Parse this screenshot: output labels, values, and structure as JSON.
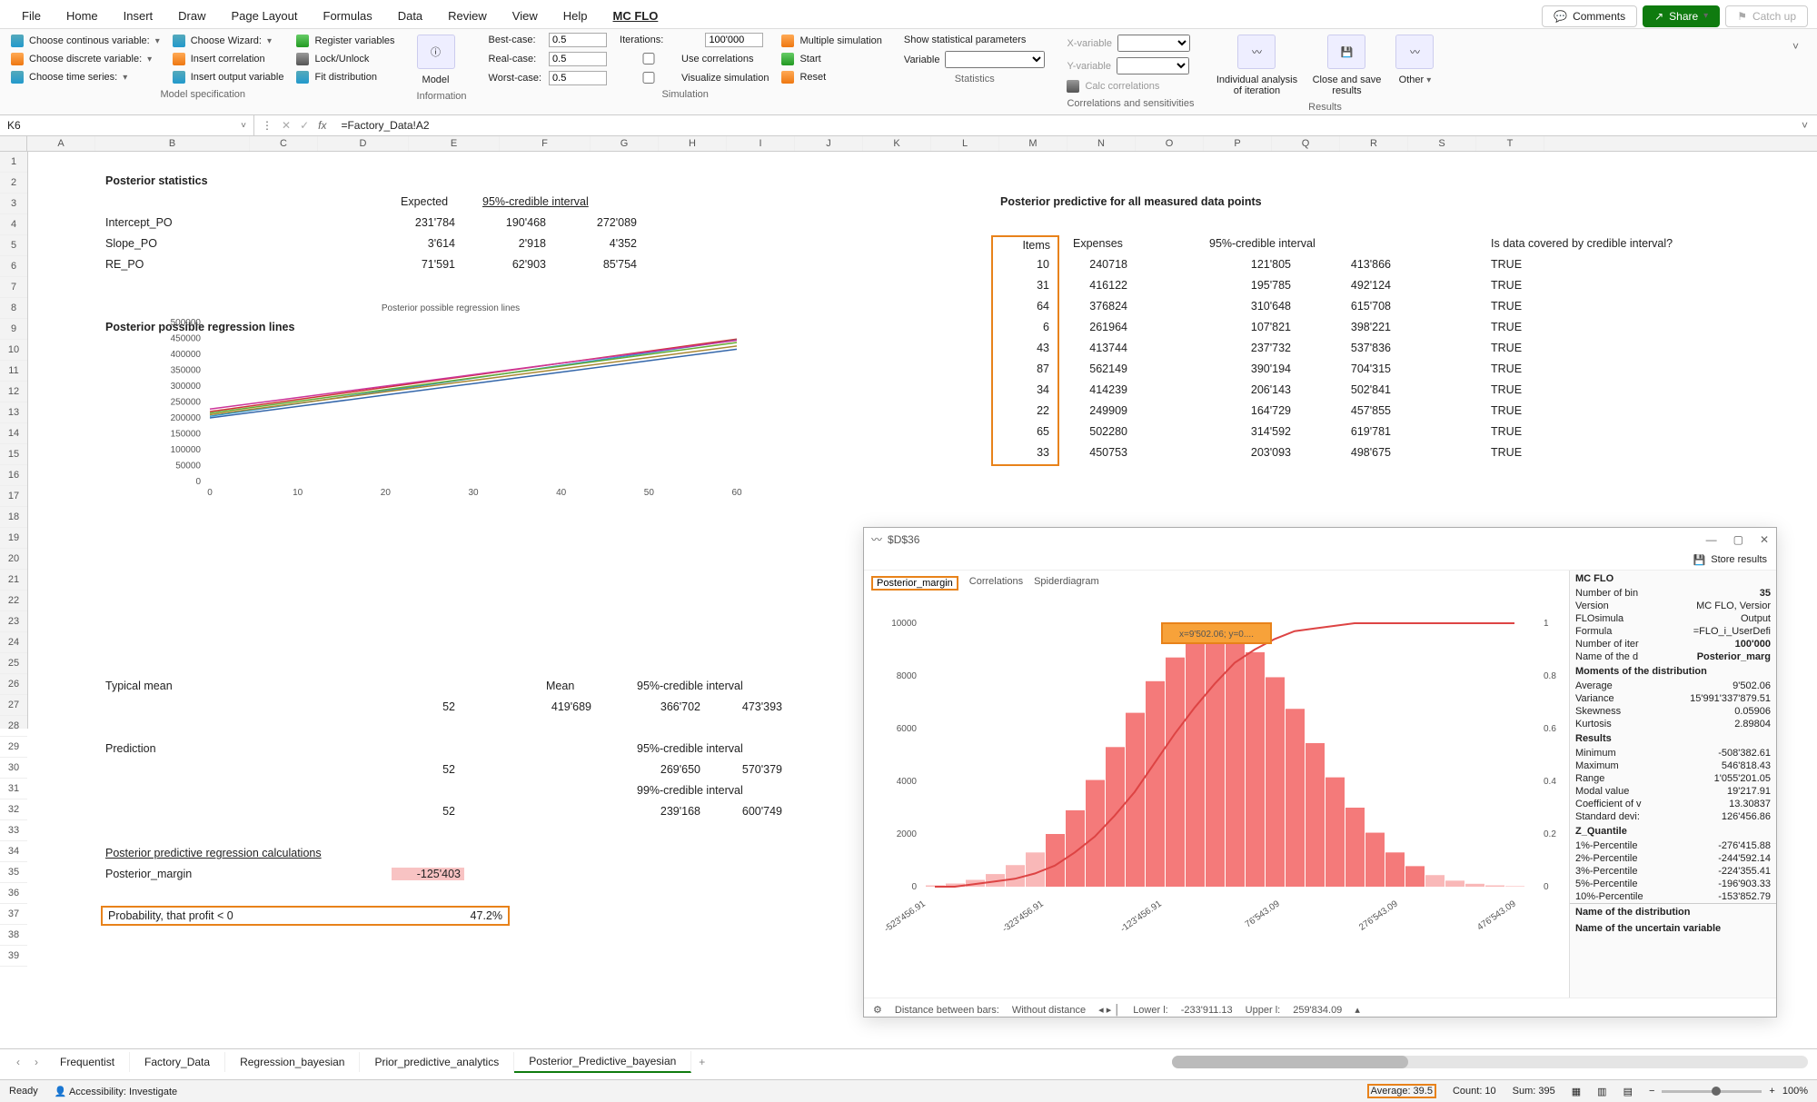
{
  "menu": {
    "tabs": [
      "File",
      "Home",
      "Insert",
      "Draw",
      "Page Layout",
      "Formulas",
      "Data",
      "Review",
      "View",
      "Help",
      "MC FLO"
    ],
    "active": "MC FLO",
    "comments": "Comments",
    "share": "Share",
    "catchup": "Catch up"
  },
  "ribbon": {
    "modelspec": {
      "cont": "Choose continous variable:",
      "disc": "Choose discrete variable:",
      "time": "Choose time series:",
      "wizard": "Choose Wizard:",
      "insertcorr": "Insert correlation",
      "insertout": "Insert output variable",
      "register": "Register variables",
      "lock": "Lock/Unlock",
      "fit": "Fit distribution",
      "label": "Model specification"
    },
    "info": {
      "model": "Model",
      "label": "Information"
    },
    "sim": {
      "best": "Best-case:",
      "real": "Real-case:",
      "worst": "Worst-case:",
      "iter": "Iterations:",
      "usecorr": "Use correlations",
      "vizsim": "Visualize simulation",
      "multi": "Multiple simulation",
      "start": "Start",
      "reset": "Reset",
      "bestv": "0.5",
      "realv": "0.5",
      "worstv": "0.5",
      "iterv": "100'000",
      "label": "Simulation"
    },
    "stats": {
      "show": "Show statistical parameters",
      "variable": "Variable",
      "label": "Statistics"
    },
    "corr": {
      "xvar": "X-variable",
      "yvar": "Y-variable",
      "calc": "Calc correlations",
      "label": "Correlations and sensitivities"
    },
    "results": {
      "ind": "Individual analysis of iteration",
      "save": "Close and save results",
      "other": "Other",
      "label": "Results"
    }
  },
  "namebox": "K6",
  "formula": "=Factory_Data!A2",
  "cols": [
    "A",
    "B",
    "C",
    "D",
    "E",
    "F",
    "G",
    "H",
    "I",
    "J",
    "K",
    "L",
    "M",
    "N",
    "O",
    "P",
    "Q",
    "R",
    "S",
    "T"
  ],
  "rows": 39,
  "sheet": {
    "ps_title": "Posterior statistics",
    "expected": "Expected",
    "ci": "95%-credible interval",
    "intercept": "Intercept_PO",
    "slope": "Slope_PO",
    "re": "RE_PO",
    "ps": [
      [
        "231'784",
        "190'468",
        "272'089"
      ],
      [
        "3'614",
        "2'918",
        "4'352"
      ],
      [
        "71'591",
        "62'903",
        "85'754"
      ]
    ],
    "prl": "Posterior possible regression lines",
    "prl_chart": "Posterior possible regression lines",
    "mean_lbl": "Typical mean",
    "mean_col": "Mean",
    "mean_ci": "95%-credible interval",
    "mean52": "52",
    "mean_v": "419'689",
    "mean_lo": "366'702",
    "mean_hi": "473'393",
    "pred": "Prediction",
    "pred_ci95": "95%-credible interval",
    "pred_lo95": "269'650",
    "pred_hi95": "570'379",
    "pred_ci99": "99%-credible interval",
    "pred_lo99": "239'168",
    "pred_hi99": "600'749",
    "pprc": "Posterior predictive regression calculations",
    "pm": "Posterior_margin",
    "pmv": "-125'403",
    "prob": "Probability, that profit < 0",
    "probv": "47.2%",
    "pp_title": "Posterior predictive for all measured data points",
    "items": "Items",
    "exp": "Expenses",
    "covered": "Is data covered by credible interval?",
    "table": [
      {
        "i": 10,
        "e": "240718",
        "lo": "121'805",
        "hi": "413'866",
        "c": "TRUE"
      },
      {
        "i": 31,
        "e": "416122",
        "lo": "195'785",
        "hi": "492'124",
        "c": "TRUE"
      },
      {
        "i": 64,
        "e": "376824",
        "lo": "310'648",
        "hi": "615'708",
        "c": "TRUE"
      },
      {
        "i": 6,
        "e": "261964",
        "lo": "107'821",
        "hi": "398'221",
        "c": "TRUE"
      },
      {
        "i": 43,
        "e": "413744",
        "lo": "237'732",
        "hi": "537'836",
        "c": "TRUE"
      },
      {
        "i": 87,
        "e": "562149",
        "lo": "390'194",
        "hi": "704'315",
        "c": "TRUE"
      },
      {
        "i": 34,
        "e": "414239",
        "lo": "206'143",
        "hi": "502'841",
        "c": "TRUE"
      },
      {
        "i": 22,
        "e": "249909",
        "lo": "164'729",
        "hi": "457'855",
        "c": "TRUE"
      },
      {
        "i": 65,
        "e": "502280",
        "lo": "314'592",
        "hi": "619'781",
        "c": "TRUE"
      },
      {
        "i": 33,
        "e": "450753",
        "lo": "203'093",
        "hi": "498'675",
        "c": "TRUE"
      }
    ]
  },
  "dlg": {
    "title": "$D$36",
    "store": "Store results",
    "tabs": [
      "Posterior_margin",
      "Correlations",
      "Spiderdiagram"
    ],
    "tooltip": "x=9'502.06; y=0....",
    "dist": "Distance between bars:",
    "distv": "Without distance",
    "ll": "Lower l:",
    "llv": "-233'911.13",
    "ul": "Upper l:",
    "ulv": "259'834.09",
    "panel": {
      "head": "MC FLO",
      "nbins": "Number of bin",
      "nbinsv": "35",
      "version": "Version",
      "versionv": "MC FLO, Versior",
      "flosim": "FLOsimula",
      "flosimv": "Output",
      "formula": "Formula",
      "formulav": "=FLO_i_UserDefi",
      "niter": "Number of iter",
      "niterv": "100'000",
      "nd": "Name of the d",
      "ndv": "Posterior_marg",
      "moments": "Moments of the distribution",
      "avg": "Average",
      "avgv": "9'502.06",
      "var": "Variance",
      "varv": "15'991'337'879.51",
      "skew": "Skewness",
      "skewv": "0.05906",
      "kurt": "Kurtosis",
      "kurtv": "2.89804",
      "results": "Results",
      "min": "Minimum",
      "minv": "-508'382.61",
      "max": "Maximum",
      "maxv": "546'818.43",
      "range": "Range",
      "rangev": "1'055'201.05",
      "modal": "Modal value",
      "modalv": "19'217.91",
      "cv": "Coefficient of v",
      "cvv": "13.30837",
      "sd": "Standard devi:",
      "sdv": "126'456.86",
      "zq": "Z_Quantile",
      "p1": "1%-Percentile",
      "p1v": "-276'415.88",
      "p2": "2%-Percentile",
      "p2v": "-244'592.14",
      "p3": "3%-Percentile",
      "p3v": "-224'355.41",
      "p5": "5%-Percentile",
      "p5v": "-196'903.33",
      "p10": "10%-Percentile",
      "p10v": "-153'852.79",
      "ndist": "Name of the distribution",
      "nuv": "Name of the uncertain variable"
    }
  },
  "chart_data": {
    "regression": {
      "type": "line",
      "title": "Posterior possible regression lines",
      "x": [
        0,
        10,
        20,
        30,
        40,
        50,
        60
      ],
      "ylim": [
        0,
        500000
      ],
      "yticks": [
        0,
        50000,
        100000,
        150000,
        200000,
        250000,
        300000,
        350000,
        400000,
        450000,
        500000
      ],
      "series": [
        {
          "color": "#c33",
          "y": [
            220000,
            258000,
            296000,
            334000,
            372000,
            410000,
            448000
          ]
        },
        {
          "color": "#39c",
          "y": [
            205000,
            245000,
            285000,
            325000,
            365000,
            405000,
            445000
          ]
        },
        {
          "color": "#c39",
          "y": [
            228000,
            264000,
            300000,
            336000,
            372000,
            408000,
            444000
          ]
        },
        {
          "color": "#6a3",
          "y": [
            215000,
            252000,
            289000,
            326000,
            363000,
            400000,
            437000
          ]
        },
        {
          "color": "#a83",
          "y": [
            210000,
            246000,
            282000,
            318000,
            354000,
            390000,
            426000
          ]
        },
        {
          "color": "#36a",
          "y": [
            200000,
            236000,
            272000,
            308000,
            344000,
            380000,
            416000
          ]
        }
      ]
    },
    "histogram": {
      "type": "bar",
      "title": "Posterior_margin",
      "xticks": [
        "-523'456.91",
        "-323'456.91",
        "-123'456.91",
        "76'543.09",
        "276'543.09",
        "476'543.09"
      ],
      "yticks_left": [
        0,
        2000,
        4000,
        6000,
        8000,
        10000
      ],
      "yticks_right": [
        0,
        0.2,
        0.4,
        0.6,
        0.8,
        1
      ],
      "bars": [
        50,
        120,
        260,
        480,
        820,
        1300,
        2000,
        2900,
        4050,
        5300,
        6600,
        7800,
        8700,
        9350,
        9600,
        9450,
        8900,
        7950,
        6750,
        5450,
        4150,
        3000,
        2050,
        1300,
        780,
        440,
        230,
        110,
        50,
        20
      ],
      "cdf": [
        0.0,
        0.0,
        0.01,
        0.02,
        0.03,
        0.05,
        0.08,
        0.13,
        0.19,
        0.27,
        0.36,
        0.47,
        0.58,
        0.68,
        0.77,
        0.85,
        0.9,
        0.94,
        0.97,
        0.98,
        0.99,
        1.0,
        1.0,
        1.0,
        1.0,
        1.0,
        1.0,
        1.0,
        1.0,
        1.0
      ]
    }
  },
  "sheets": [
    "Frequentist",
    "Factory_Data",
    "Regression_bayesian",
    "Prior_predictive_analytics",
    "Posterior_Predictive_bayesian"
  ],
  "status": {
    "ready": "Ready",
    "acc": "Accessibility: Investigate",
    "avg": "Average: 39.5",
    "count": "Count: 10",
    "sum": "Sum: 395",
    "zoom": "100%"
  }
}
